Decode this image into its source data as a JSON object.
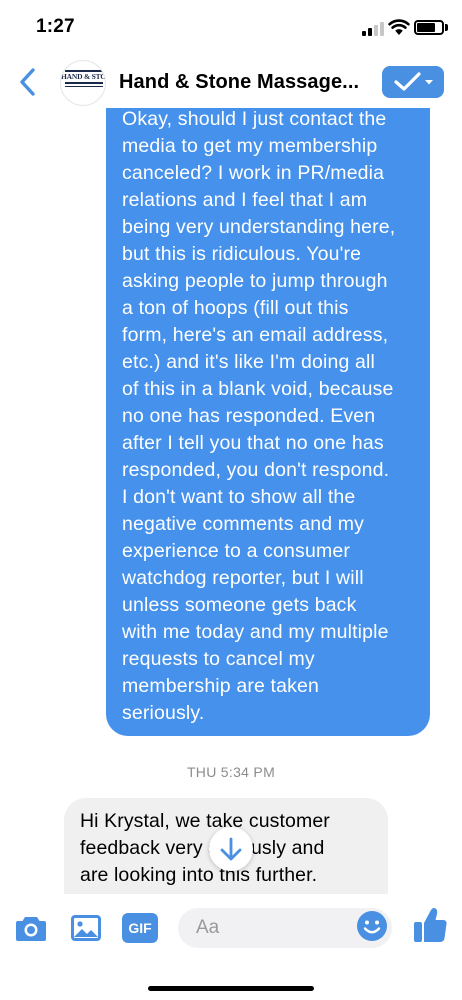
{
  "status_bar": {
    "time": "1:27"
  },
  "header": {
    "avatar_text": "HAND & STONE",
    "title": "Hand & Stone Massage...",
    "back_icon": "chevron-left-icon",
    "action_icon": "checkmark-dropdown-icon"
  },
  "messages": {
    "sent": {
      "text": "Okay, should I just contact the\nmedia to get my membership\ncanceled? I work in PR/media\nrelations and I feel that I am\nbeing very understanding here,\nbut this is ridiculous. You're\nasking people to jump through\na ton of hoops (fill out this\nform, here's an email address,\netc.) and it's like I'm doing all\nof this in a blank void, because\nno one has responded. Even\nafter I tell you that no one has\nresponded, you don't respond.\nI don't want to show all the\nnegative comments and my\nexperience to a consumer\nwatchdog reporter, but I will\nunless someone gets back\nwith me today and my multiple\nrequests to cancel my\nmembership are  taken\nseriously."
    },
    "timestamp": "THU 5:34 PM",
    "received": {
      "text": "Hi Krystal, we take customer\nfeedback very seriously and\nare looking into this further."
    }
  },
  "composer": {
    "placeholder": "Aa",
    "gif_label": "GIF"
  },
  "colors": {
    "accent": "#4a90e2",
    "sent_bubble": "#4591ec",
    "received_bubble": "#f0f0f0"
  }
}
